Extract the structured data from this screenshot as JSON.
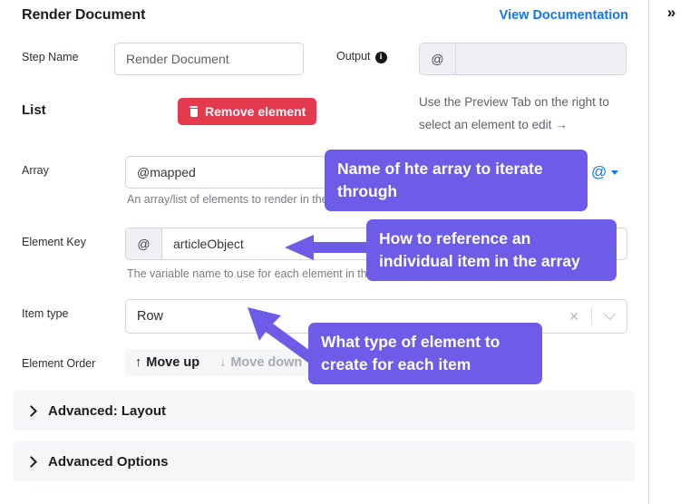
{
  "panel": {
    "title": "Render Document",
    "documentation_link": "View Documentation"
  },
  "right_rail": {
    "collapse_icon": "double-chevron-right",
    "collapse_glyph": "»"
  },
  "fields": {
    "step_name": {
      "label": "Step Name",
      "value": "Render Document",
      "placeholder": "Render Document"
    },
    "output": {
      "label": "Output",
      "info_icon": "info-icon",
      "prefix": "@",
      "value": ""
    },
    "preview_hint": "Use the Preview Tab on the right to select an element to edit →"
  },
  "list_section": {
    "heading": "List",
    "remove_button": {
      "label": "Remove element",
      "icon": "trash-icon",
      "color": "#e33a4e"
    },
    "array": {
      "label": "Array",
      "value": "@mapped",
      "helper": "An array/list of elements to render in the document",
      "token_icon": "at-icon",
      "token_caret": "chevron-down-icon"
    },
    "element_key": {
      "label": "Element Key",
      "prefix": "@",
      "value": "articleObject",
      "helper": "The variable name to use for each element in the array/list"
    },
    "item_type": {
      "label": "Item type",
      "value": "Row",
      "clear_icon": "close-icon",
      "dropdown_icon": "chevron-down-icon"
    },
    "element_order": {
      "label": "Element Order",
      "move_up": "Move up",
      "move_up_icon": "arrow-up-icon",
      "move_down": "Move down",
      "move_down_icon": "arrow-down-icon"
    }
  },
  "accordions": [
    {
      "label": "Advanced: Layout",
      "icon": "chevron-right-icon"
    },
    {
      "label": "Advanced Options",
      "icon": "chevron-right-icon"
    }
  ],
  "annotations": {
    "color": "#6c5ce7",
    "items": [
      {
        "text": "Name of hte array to iterate through"
      },
      {
        "text": "How to reference an individual item in the array"
      },
      {
        "text": "What type of element to create for each item"
      }
    ]
  }
}
